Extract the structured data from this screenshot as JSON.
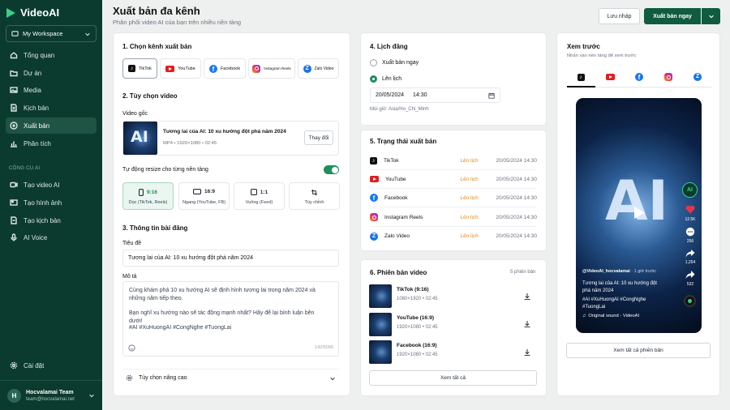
{
  "brand": {
    "name": "VideoAI"
  },
  "workspace": {
    "label": "My Workspace"
  },
  "nav": {
    "items": [
      {
        "label": "Tổng quan"
      },
      {
        "label": "Dự án"
      },
      {
        "label": "Media"
      },
      {
        "label": "Kịch bản"
      },
      {
        "label": "Xuất bản"
      },
      {
        "label": "Phân tích"
      }
    ],
    "tools_label": "CÔNG CỤ AI",
    "tools": [
      {
        "label": "Tạo video AI"
      },
      {
        "label": "Tạo hình ảnh"
      },
      {
        "label": "Tạo kịch bản"
      },
      {
        "label": "AI Voice"
      }
    ],
    "settings": "Cài đặt"
  },
  "user": {
    "initial": "H",
    "name": "Hocvalamai Team",
    "email": "team@hocvalamai.net"
  },
  "header": {
    "title": "Xuất bản đa kênh",
    "subtitle": "Phân phối video AI của bạn trên nhiều nền tảng",
    "draft": "Lưu nháp",
    "publish": "Xuất bản ngay"
  },
  "channels": {
    "heading": "1. Chọn kênh xuất bản",
    "items": [
      {
        "label": "TikTok"
      },
      {
        "label": "YouTube"
      },
      {
        "label": "Facebook"
      },
      {
        "label": "Instagram Reels"
      },
      {
        "label": "Zalo Video"
      }
    ]
  },
  "video": {
    "heading": "2. Tùy chọn video",
    "source_label": "Video gốc",
    "title": "Tương lai của AI: 10 xu hướng đột phá năm 2024",
    "meta": "MP4  •  1920×1080  •  02:45",
    "change": "Thay đổi",
    "thumb_text": "AI",
    "resize_label": "Tự động resize cho từng nền tảng",
    "resize_on": true,
    "ratios": [
      {
        "ratio": "9:16",
        "desc": "Dọc (TikTok, Reels)"
      },
      {
        "ratio": "16:9",
        "desc": "Ngang (YouTube, FB)"
      },
      {
        "ratio": "1:1",
        "desc": "Vuông (Feed)"
      },
      {
        "ratio": "",
        "desc": "Tùy chỉnh"
      }
    ]
  },
  "post": {
    "heading": "3. Thông tin bài đăng",
    "title_label": "Tiêu đề",
    "title_value": "Tương lai của AI: 10 xu hướng đột phá năm 2024",
    "desc_label": "Mô tả",
    "desc_lines": [
      "Cùng khám phá 10 xu hướng AI sẽ định hình tương lai trong năm 2024 và những năm tiếp theo.",
      "Bạn nghĩ xu hướng nào sẽ tác động mạnh nhất? Hãy để lại bình luận bên dưới!",
      "#AI #XuHuongAI #CongNghe #TuongLai"
    ],
    "counter": "142/5000",
    "advanced": "Tùy chọn nâng cao"
  },
  "schedule": {
    "heading": "4. Lịch đăng",
    "now": "Xuất bản ngay",
    "later": "Lên lịch",
    "date": "20/05/2024",
    "time": "14:30",
    "timezone": "Múi giờ: Asia/Ho_Chi_Minh"
  },
  "status": {
    "heading": "5. Trạng thái xuất bản",
    "rows": [
      {
        "name": "TikTok",
        "state": "Lên lịch",
        "time": "20/05/2024 14:30"
      },
      {
        "name": "YouTube",
        "state": "Lên lịch",
        "time": "20/05/2024 14:30"
      },
      {
        "name": "Facebook",
        "state": "Lên lịch",
        "time": "20/05/2024 14:30"
      },
      {
        "name": "Instagram Reels",
        "state": "Lên lịch",
        "time": "20/05/2024 14:30"
      },
      {
        "name": "Zalo Video",
        "state": "Lên lịch",
        "time": "20/05/2024 14:30"
      }
    ]
  },
  "versions": {
    "heading": "6. Phiên bản video",
    "count": "5 phiên bản",
    "items": [
      {
        "title": "TikTok (9:16)",
        "meta": "1080×1920  •  02:45"
      },
      {
        "title": "YouTube (16:9)",
        "meta": "1920×1080  •  02:45"
      },
      {
        "title": "Facebook (16:9)",
        "meta": "1920×1080  •  02:45"
      }
    ],
    "see_all": "Xem tất cả"
  },
  "preview": {
    "heading": "Xem trước",
    "sub": "Nhấn vào nền tảng để xem trước",
    "handle": "@VideoAI_hocvalamai",
    "ago": "· 1 giờ trước",
    "caption": "Tương lai của AI: 10 xu hướng đột phá năm 2024",
    "tags": "#AI #XuHuongAI #CongNghe #TuongLai",
    "sound": "Original sound - VideoAI",
    "likes": "12.5K",
    "comments": "256",
    "shares": "1,254",
    "forwards": "532",
    "badge": "AI",
    "see_all": "Xem tất cả phiên bản"
  },
  "colors": {
    "sidebar": "#0b3b2e",
    "accent": "#1e8f5e",
    "primary_button": "#0f5c3f",
    "scheduled": "#e08a1e"
  }
}
